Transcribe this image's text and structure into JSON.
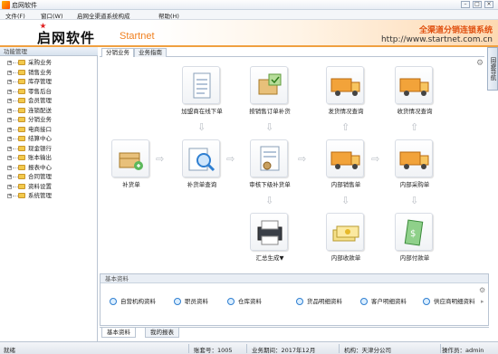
{
  "window": {
    "title": "启网软件"
  },
  "menu": [
    "文件(F)",
    "窗口(W)",
    "启网全渠道系统构成",
    "帮助(H)"
  ],
  "banner": {
    "logo_cn": "启网软件",
    "logo_en": "Startnet",
    "slogan": "全渠道分销连锁系统",
    "url": "http://www.startnet.com.cn"
  },
  "sidebar": {
    "header": "功能管理",
    "items": [
      "采购业务",
      "销售业务",
      "库存管理",
      "零售后台",
      "会员管理",
      "连锁配送",
      "分销业务",
      "电商接口",
      "结算中心",
      "现金银行",
      "账本输出",
      "报表中心",
      "合同管理",
      "资料设置",
      "系统管理"
    ]
  },
  "tabs": [
    "分销业务",
    "业务指南"
  ],
  "side_button": "回避导航",
  "flow": {
    "nodes": {
      "online_order": "加盟商在线下单",
      "replenish_sub": "按销售订单补货",
      "ship_query": "发货情况查询",
      "receive_query": "收货情况查询",
      "replenish": "补货单",
      "replenish_query": "补货单查询",
      "audit_order": "审核下级补货单",
      "internal_sales": "内部销售单",
      "internal_purchase": "内部采购单",
      "summary": "汇总生成▼",
      "internal_receipt": "内部收款单",
      "internal_payment": "内部付款单"
    }
  },
  "base_panel": {
    "header": "基本资料",
    "items": [
      "自营机构资料",
      "职员资料",
      "仓库资料",
      "货品明细资料",
      "客户明细资料",
      "供应商明细资料"
    ]
  },
  "bottom_tabs": [
    "基本资料",
    "我的报表"
  ],
  "status": {
    "left": "就绪",
    "account_no": "账套号：1005",
    "period": "业务期间：2017年12月",
    "org": "机构：天津分公司",
    "operator": "操作员：admin"
  }
}
